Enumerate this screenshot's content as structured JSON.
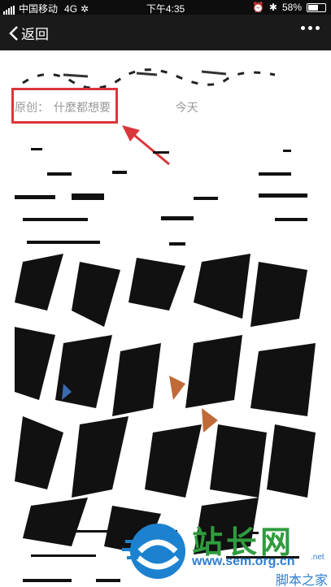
{
  "status_bar": {
    "carrier": "中国移动",
    "network": "4G",
    "time": "下午4:35",
    "battery": "58%",
    "battery_level": 0.58
  },
  "nav": {
    "back_label": "返回",
    "more_icon": "more-dots-icon"
  },
  "article": {
    "original_label": "原创：",
    "author": "什麼都想要",
    "date": "今天"
  },
  "annotation": {
    "highlight_color": "#d9363b"
  },
  "watermark": {
    "cn_title": "站长网",
    "url": "www.sem.org.cn",
    "net": ".net",
    "site": "脚本之家"
  }
}
